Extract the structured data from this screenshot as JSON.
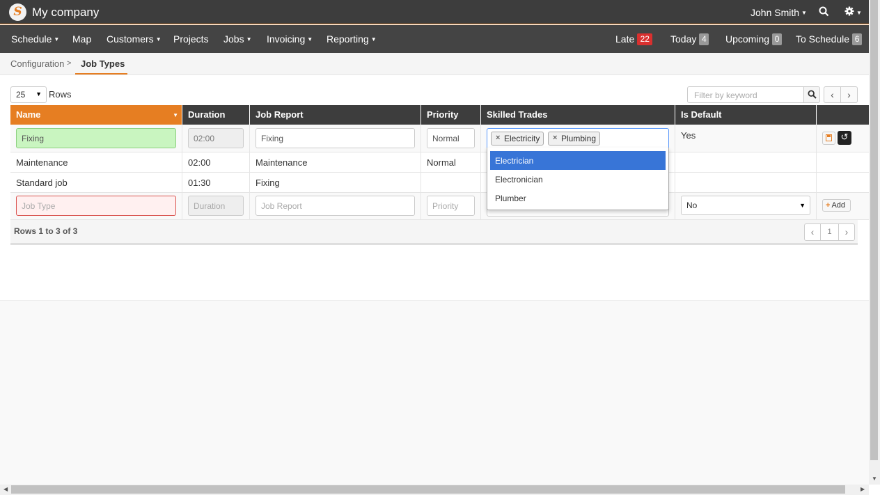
{
  "app": {
    "logo_letter": "S",
    "title": "My company"
  },
  "topbar": {
    "user": "John Smith",
    "search_icon": "search-icon",
    "settings_icon": "gear-icon"
  },
  "nav": {
    "items": [
      "Schedule",
      "Map",
      "Customers",
      "Projects",
      "Jobs",
      "Invoicing",
      "Reporting"
    ],
    "counters": [
      {
        "label": "Late",
        "count": "22",
        "color": "#d9302f"
      },
      {
        "label": "Today",
        "count": "4",
        "color": "#999999"
      },
      {
        "label": "Upcoming",
        "count": "0",
        "color": "#999999"
      },
      {
        "label": "To Schedule",
        "count": "6",
        "color": "#999999"
      }
    ]
  },
  "breadcrumb": {
    "parent": "Configuration",
    "current": "Job Types"
  },
  "toolbar": {
    "rows_per_page": "25",
    "rows_label": "Rows",
    "filter_placeholder": "Filter by keyword"
  },
  "table": {
    "columns": [
      "Name",
      "Duration",
      "Job Report",
      "Priority",
      "Skilled Trades",
      "Is Default"
    ],
    "edit_row": {
      "name": "Fixing",
      "duration": "02:00",
      "job_report": "Fixing",
      "priority": "Normal",
      "skilled_trades": [
        "Electricity",
        "Plumbing"
      ],
      "is_default": "Yes"
    },
    "rows": [
      {
        "name": "Maintenance",
        "duration": "02:00",
        "job_report": "Maintenance",
        "priority": "Normal"
      },
      {
        "name": "Standard job",
        "duration": "01:30",
        "job_report": "Fixing",
        "priority": ""
      }
    ],
    "new_row": {
      "name_placeholder": "Job Type",
      "duration_placeholder": "Duration",
      "job_report_placeholder": "Job Report",
      "priority_placeholder": "Priority",
      "is_default_value": "No",
      "add_label": "Add"
    },
    "trade_options": [
      "Electrician",
      "Electronician",
      "Plumber"
    ],
    "highlighted_option": "Electrician",
    "footer": {
      "summary": "Rows 1 to 3 of 3",
      "page": "1"
    }
  },
  "colors": {
    "accent": "#e67e22",
    "header_bg": "#3d3d3d",
    "highlight": "#3875d7"
  }
}
